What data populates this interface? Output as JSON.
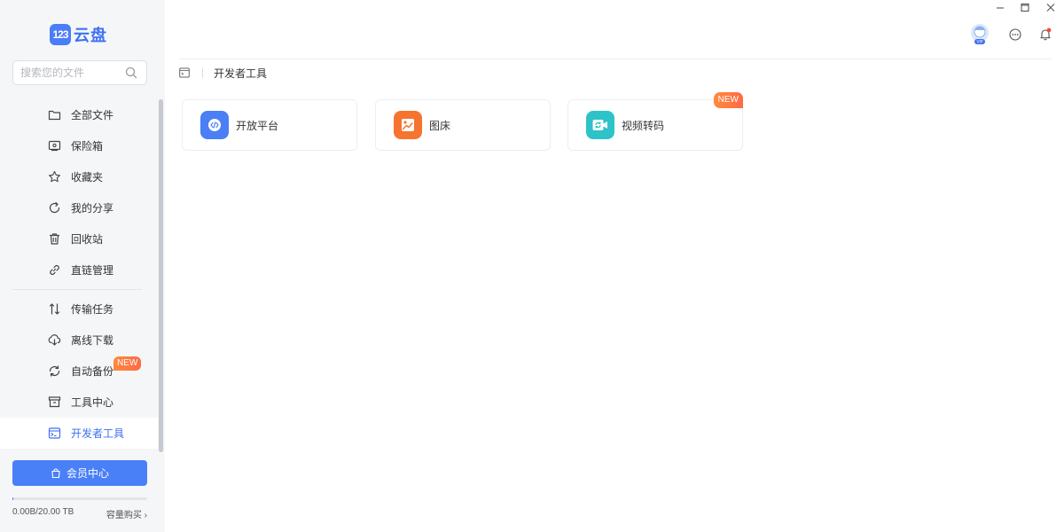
{
  "brand": {
    "logo_mark": "123",
    "name": "云盘",
    "color": "#3f72f3"
  },
  "search": {
    "placeholder": "搜索您的文件"
  },
  "sidebar": {
    "items": [
      {
        "label": "全部文件",
        "icon": "folder-icon"
      },
      {
        "label": "保险箱",
        "icon": "safe-icon"
      },
      {
        "label": "收藏夹",
        "icon": "star-icon"
      },
      {
        "label": "我的分享",
        "icon": "share-icon"
      },
      {
        "label": "回收站",
        "icon": "trash-icon"
      },
      {
        "label": "直链管理",
        "icon": "link-icon"
      }
    ],
    "items2": [
      {
        "label": "传输任务",
        "icon": "transfer-icon"
      },
      {
        "label": "离线下载",
        "icon": "download-cloud-icon"
      },
      {
        "label": "自动备份",
        "icon": "sync-icon",
        "badge": "NEW"
      },
      {
        "label": "工具中心",
        "icon": "toolbox-icon"
      },
      {
        "label": "开发者工具",
        "icon": "terminal-icon",
        "active": true
      }
    ]
  },
  "vip": {
    "label": "会员中心"
  },
  "storage": {
    "text": "0.00B/20.00 TB",
    "buy_label": "容量购买",
    "used_fraction": 0
  },
  "breadcrumb": {
    "current": "开发者工具"
  },
  "tools": [
    {
      "label": "开放平台",
      "icon": "code-icon",
      "color": "#4a7ff5"
    },
    {
      "label": "图床",
      "icon": "image-icon",
      "color": "#f6742f"
    },
    {
      "label": "视频转码",
      "icon": "video-convert-icon",
      "color": "#2ec2c9",
      "badge": "NEW"
    }
  ],
  "accent": "#4a80f7"
}
